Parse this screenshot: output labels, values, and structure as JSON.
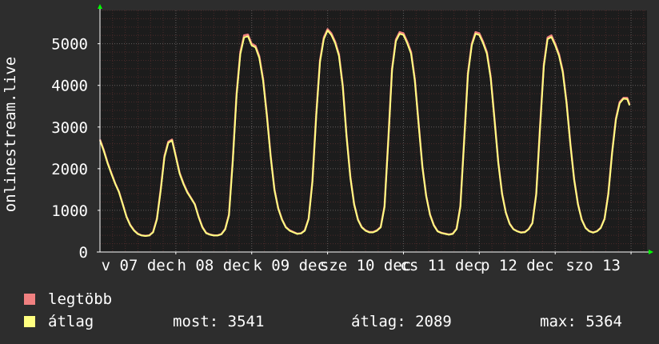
{
  "chart_data": {
    "type": "line",
    "ylabel": "onlinestream.live",
    "ylim": [
      0,
      5800
    ],
    "yticks": [
      0,
      1000,
      2000,
      3000,
      4000,
      5000
    ],
    "xlim": [
      0,
      7.21
    ],
    "xticks": [
      {
        "x": 0.5,
        "label": "v 07 dec"
      },
      {
        "x": 1.5,
        "label": "h 08 dec"
      },
      {
        "x": 2.5,
        "label": "k 09 dec"
      },
      {
        "x": 3.5,
        "label": "sze 10 dec"
      },
      {
        "x": 4.5,
        "label": "cs 11 dec"
      },
      {
        "x": 5.5,
        "label": "p 12 dec"
      },
      {
        "x": 6.5,
        "label": "szo 13"
      }
    ],
    "series": [
      {
        "name": "legtöbb",
        "color": "#f08080",
        "points": [
          [
            0.0,
            2700
          ],
          [
            0.05,
            2450
          ],
          [
            0.1,
            2150
          ],
          [
            0.15,
            1900
          ],
          [
            0.2,
            1650
          ],
          [
            0.25,
            1450
          ],
          [
            0.3,
            1150
          ],
          [
            0.35,
            850
          ],
          [
            0.4,
            650
          ],
          [
            0.45,
            520
          ],
          [
            0.5,
            440
          ],
          [
            0.55,
            400
          ],
          [
            0.6,
            390
          ],
          [
            0.65,
            400
          ],
          [
            0.7,
            480
          ],
          [
            0.75,
            800
          ],
          [
            0.8,
            1500
          ],
          [
            0.85,
            2300
          ],
          [
            0.9,
            2650
          ],
          [
            0.95,
            2700
          ],
          [
            1.0,
            2300
          ],
          [
            1.05,
            1900
          ],
          [
            1.1,
            1650
          ],
          [
            1.15,
            1450
          ],
          [
            1.2,
            1300
          ],
          [
            1.25,
            1150
          ],
          [
            1.3,
            850
          ],
          [
            1.35,
            600
          ],
          [
            1.4,
            460
          ],
          [
            1.45,
            420
          ],
          [
            1.5,
            400
          ],
          [
            1.55,
            400
          ],
          [
            1.6,
            430
          ],
          [
            1.65,
            550
          ],
          [
            1.7,
            900
          ],
          [
            1.75,
            2200
          ],
          [
            1.8,
            3800
          ],
          [
            1.85,
            4800
          ],
          [
            1.9,
            5200
          ],
          [
            1.95,
            5220
          ],
          [
            2.0,
            5000
          ],
          [
            2.05,
            4950
          ],
          [
            2.1,
            4700
          ],
          [
            2.15,
            4150
          ],
          [
            2.2,
            3300
          ],
          [
            2.25,
            2300
          ],
          [
            2.3,
            1500
          ],
          [
            2.35,
            1050
          ],
          [
            2.4,
            780
          ],
          [
            2.45,
            600
          ],
          [
            2.5,
            520
          ],
          [
            2.55,
            480
          ],
          [
            2.6,
            440
          ],
          [
            2.65,
            450
          ],
          [
            2.7,
            520
          ],
          [
            2.75,
            800
          ],
          [
            2.8,
            1700
          ],
          [
            2.85,
            3300
          ],
          [
            2.9,
            4600
          ],
          [
            2.95,
            5150
          ],
          [
            3.0,
            5350
          ],
          [
            3.05,
            5250
          ],
          [
            3.1,
            5050
          ],
          [
            3.15,
            4750
          ],
          [
            3.2,
            4000
          ],
          [
            3.25,
            2800
          ],
          [
            3.3,
            1800
          ],
          [
            3.35,
            1150
          ],
          [
            3.4,
            780
          ],
          [
            3.45,
            600
          ],
          [
            3.5,
            520
          ],
          [
            3.55,
            480
          ],
          [
            3.6,
            480
          ],
          [
            3.65,
            520
          ],
          [
            3.7,
            600
          ],
          [
            3.75,
            1100
          ],
          [
            3.8,
            2700
          ],
          [
            3.85,
            4400
          ],
          [
            3.9,
            5100
          ],
          [
            3.95,
            5280
          ],
          [
            4.0,
            5250
          ],
          [
            4.05,
            5050
          ],
          [
            4.1,
            4800
          ],
          [
            4.15,
            4150
          ],
          [
            4.2,
            3100
          ],
          [
            4.25,
            2050
          ],
          [
            4.3,
            1350
          ],
          [
            4.35,
            900
          ],
          [
            4.4,
            650
          ],
          [
            4.45,
            500
          ],
          [
            4.5,
            460
          ],
          [
            4.55,
            440
          ],
          [
            4.6,
            420
          ],
          [
            4.65,
            440
          ],
          [
            4.7,
            560
          ],
          [
            4.75,
            1100
          ],
          [
            4.8,
            2700
          ],
          [
            4.85,
            4300
          ],
          [
            4.9,
            5000
          ],
          [
            4.95,
            5280
          ],
          [
            5.0,
            5250
          ],
          [
            5.05,
            5050
          ],
          [
            5.1,
            4800
          ],
          [
            5.15,
            4200
          ],
          [
            5.2,
            3200
          ],
          [
            5.25,
            2150
          ],
          [
            5.3,
            1400
          ],
          [
            5.35,
            950
          ],
          [
            5.4,
            680
          ],
          [
            5.45,
            550
          ],
          [
            5.5,
            500
          ],
          [
            5.55,
            470
          ],
          [
            5.6,
            480
          ],
          [
            5.65,
            550
          ],
          [
            5.7,
            700
          ],
          [
            5.75,
            1400
          ],
          [
            5.8,
            3000
          ],
          [
            5.85,
            4500
          ],
          [
            5.9,
            5150
          ],
          [
            5.95,
            5200
          ],
          [
            6.0,
            5000
          ],
          [
            6.05,
            4750
          ],
          [
            6.1,
            4350
          ],
          [
            6.15,
            3600
          ],
          [
            6.2,
            2600
          ],
          [
            6.25,
            1750
          ],
          [
            6.3,
            1150
          ],
          [
            6.35,
            780
          ],
          [
            6.4,
            580
          ],
          [
            6.45,
            500
          ],
          [
            6.5,
            470
          ],
          [
            6.55,
            500
          ],
          [
            6.6,
            580
          ],
          [
            6.65,
            800
          ],
          [
            6.7,
            1400
          ],
          [
            6.75,
            2400
          ],
          [
            6.8,
            3200
          ],
          [
            6.85,
            3600
          ],
          [
            6.9,
            3700
          ],
          [
            6.95,
            3700
          ],
          [
            6.98,
            3541
          ]
        ]
      },
      {
        "name": "átlag",
        "color": "#ffff80",
        "points": [
          [
            0.0,
            2680
          ],
          [
            0.05,
            2430
          ],
          [
            0.1,
            2130
          ],
          [
            0.15,
            1880
          ],
          [
            0.2,
            1640
          ],
          [
            0.25,
            1440
          ],
          [
            0.3,
            1140
          ],
          [
            0.35,
            840
          ],
          [
            0.4,
            640
          ],
          [
            0.45,
            510
          ],
          [
            0.5,
            430
          ],
          [
            0.55,
            395
          ],
          [
            0.6,
            385
          ],
          [
            0.65,
            395
          ],
          [
            0.7,
            470
          ],
          [
            0.75,
            780
          ],
          [
            0.8,
            1470
          ],
          [
            0.85,
            2270
          ],
          [
            0.9,
            2620
          ],
          [
            0.95,
            2680
          ],
          [
            1.0,
            2280
          ],
          [
            1.05,
            1880
          ],
          [
            1.1,
            1630
          ],
          [
            1.15,
            1430
          ],
          [
            1.2,
            1290
          ],
          [
            1.25,
            1140
          ],
          [
            1.3,
            840
          ],
          [
            1.35,
            590
          ],
          [
            1.4,
            450
          ],
          [
            1.45,
            415
          ],
          [
            1.5,
            395
          ],
          [
            1.55,
            395
          ],
          [
            1.6,
            425
          ],
          [
            1.65,
            540
          ],
          [
            1.7,
            880
          ],
          [
            1.75,
            2150
          ],
          [
            1.8,
            3750
          ],
          [
            1.85,
            4750
          ],
          [
            1.9,
            5150
          ],
          [
            1.95,
            5180
          ],
          [
            2.0,
            4960
          ],
          [
            2.05,
            4910
          ],
          [
            2.1,
            4660
          ],
          [
            2.15,
            4110
          ],
          [
            2.2,
            3260
          ],
          [
            2.25,
            2270
          ],
          [
            2.3,
            1480
          ],
          [
            2.35,
            1040
          ],
          [
            2.4,
            770
          ],
          [
            2.45,
            590
          ],
          [
            2.5,
            510
          ],
          [
            2.55,
            470
          ],
          [
            2.6,
            435
          ],
          [
            2.65,
            445
          ],
          [
            2.7,
            510
          ],
          [
            2.75,
            790
          ],
          [
            2.8,
            1670
          ],
          [
            2.85,
            3260
          ],
          [
            2.9,
            4560
          ],
          [
            2.95,
            5110
          ],
          [
            3.0,
            5320
          ],
          [
            3.05,
            5210
          ],
          [
            3.1,
            5010
          ],
          [
            3.15,
            4710
          ],
          [
            3.2,
            3960
          ],
          [
            3.25,
            2770
          ],
          [
            3.3,
            1780
          ],
          [
            3.35,
            1140
          ],
          [
            3.4,
            770
          ],
          [
            3.45,
            590
          ],
          [
            3.5,
            510
          ],
          [
            3.55,
            470
          ],
          [
            3.6,
            470
          ],
          [
            3.65,
            510
          ],
          [
            3.7,
            590
          ],
          [
            3.75,
            1080
          ],
          [
            3.8,
            2660
          ],
          [
            3.85,
            4360
          ],
          [
            3.9,
            5060
          ],
          [
            3.95,
            5240
          ],
          [
            4.0,
            5210
          ],
          [
            4.05,
            5010
          ],
          [
            4.1,
            4760
          ],
          [
            4.15,
            4110
          ],
          [
            4.2,
            3070
          ],
          [
            4.25,
            2030
          ],
          [
            4.3,
            1340
          ],
          [
            4.35,
            890
          ],
          [
            4.4,
            640
          ],
          [
            4.45,
            495
          ],
          [
            4.5,
            455
          ],
          [
            4.55,
            435
          ],
          [
            4.6,
            415
          ],
          [
            4.65,
            435
          ],
          [
            4.7,
            550
          ],
          [
            4.75,
            1080
          ],
          [
            4.8,
            2660
          ],
          [
            4.85,
            4260
          ],
          [
            4.9,
            4960
          ],
          [
            4.95,
            5240
          ],
          [
            5.0,
            5210
          ],
          [
            5.05,
            5010
          ],
          [
            5.1,
            4760
          ],
          [
            5.15,
            4160
          ],
          [
            5.2,
            3170
          ],
          [
            5.25,
            2130
          ],
          [
            5.3,
            1390
          ],
          [
            5.35,
            940
          ],
          [
            5.4,
            670
          ],
          [
            5.45,
            545
          ],
          [
            5.5,
            495
          ],
          [
            5.55,
            465
          ],
          [
            5.6,
            475
          ],
          [
            5.65,
            545
          ],
          [
            5.7,
            690
          ],
          [
            5.75,
            1380
          ],
          [
            5.8,
            2960
          ],
          [
            5.85,
            4460
          ],
          [
            5.9,
            5110
          ],
          [
            5.95,
            5160
          ],
          [
            6.0,
            4960
          ],
          [
            6.05,
            4710
          ],
          [
            6.1,
            4310
          ],
          [
            6.15,
            3570
          ],
          [
            6.2,
            2580
          ],
          [
            6.25,
            1730
          ],
          [
            6.3,
            1140
          ],
          [
            6.35,
            770
          ],
          [
            6.4,
            575
          ],
          [
            6.45,
            495
          ],
          [
            6.5,
            465
          ],
          [
            6.55,
            495
          ],
          [
            6.6,
            575
          ],
          [
            6.65,
            790
          ],
          [
            6.7,
            1380
          ],
          [
            6.75,
            2380
          ],
          [
            6.8,
            3170
          ],
          [
            6.85,
            3570
          ],
          [
            6.9,
            3680
          ],
          [
            6.95,
            3670
          ],
          [
            6.98,
            3520
          ]
        ]
      }
    ],
    "legend_placement": "bottom-left",
    "grid": true
  },
  "legend": {
    "max_label": "legtöbb",
    "avg_label": "átlag",
    "max_color": "#f08080",
    "avg_color": "#ffff80"
  },
  "stats": {
    "now": "most: 3541",
    "avg": "átlag: 2089",
    "max": "max: 5364"
  },
  "colors": {
    "background": "#2d2d2d",
    "plot_background": "#1c1c1c",
    "grid_minor": "#4a2a2a",
    "grid_major": "#5a5a5a",
    "axis_arrow": "#00ff00",
    "axis": "#ffffff"
  }
}
